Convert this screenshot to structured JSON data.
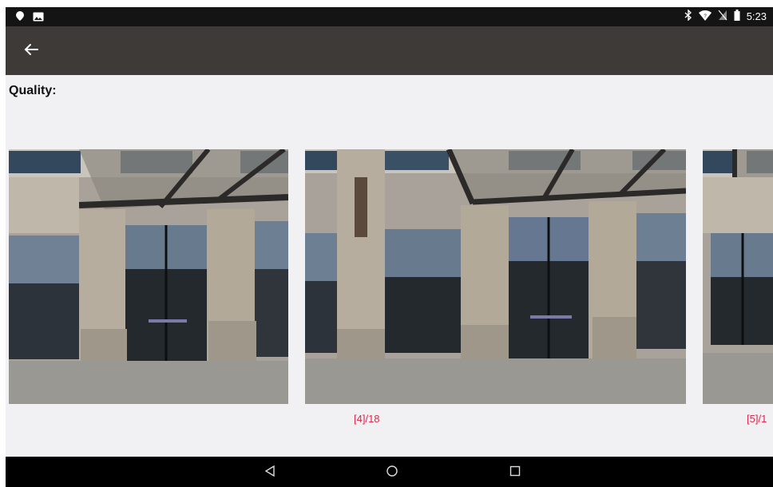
{
  "status_bar": {
    "time": "5:23",
    "left_icons": [
      "pin-notification-icon",
      "image-notification-icon"
    ],
    "right_icons": [
      "bluetooth-icon",
      "wifi-icon",
      "no-sim-icon",
      "battery-icon"
    ]
  },
  "toolbar": {
    "back_icon": "arrow-left-icon"
  },
  "main": {
    "quality_label": "Quality:",
    "photos": [
      {
        "caption": ""
      },
      {
        "caption": "[4]/18"
      },
      {
        "caption": "[5]/1"
      }
    ]
  },
  "nav_bar": {
    "icons": [
      "back-triangle-icon",
      "home-circle-icon",
      "recents-square-icon"
    ]
  },
  "colors": {
    "status_bar": "#141414",
    "toolbar": "#3d3a37",
    "content_bg": "#f1f1f3",
    "caption": "#e0264e",
    "nav_bar": "#000000"
  }
}
